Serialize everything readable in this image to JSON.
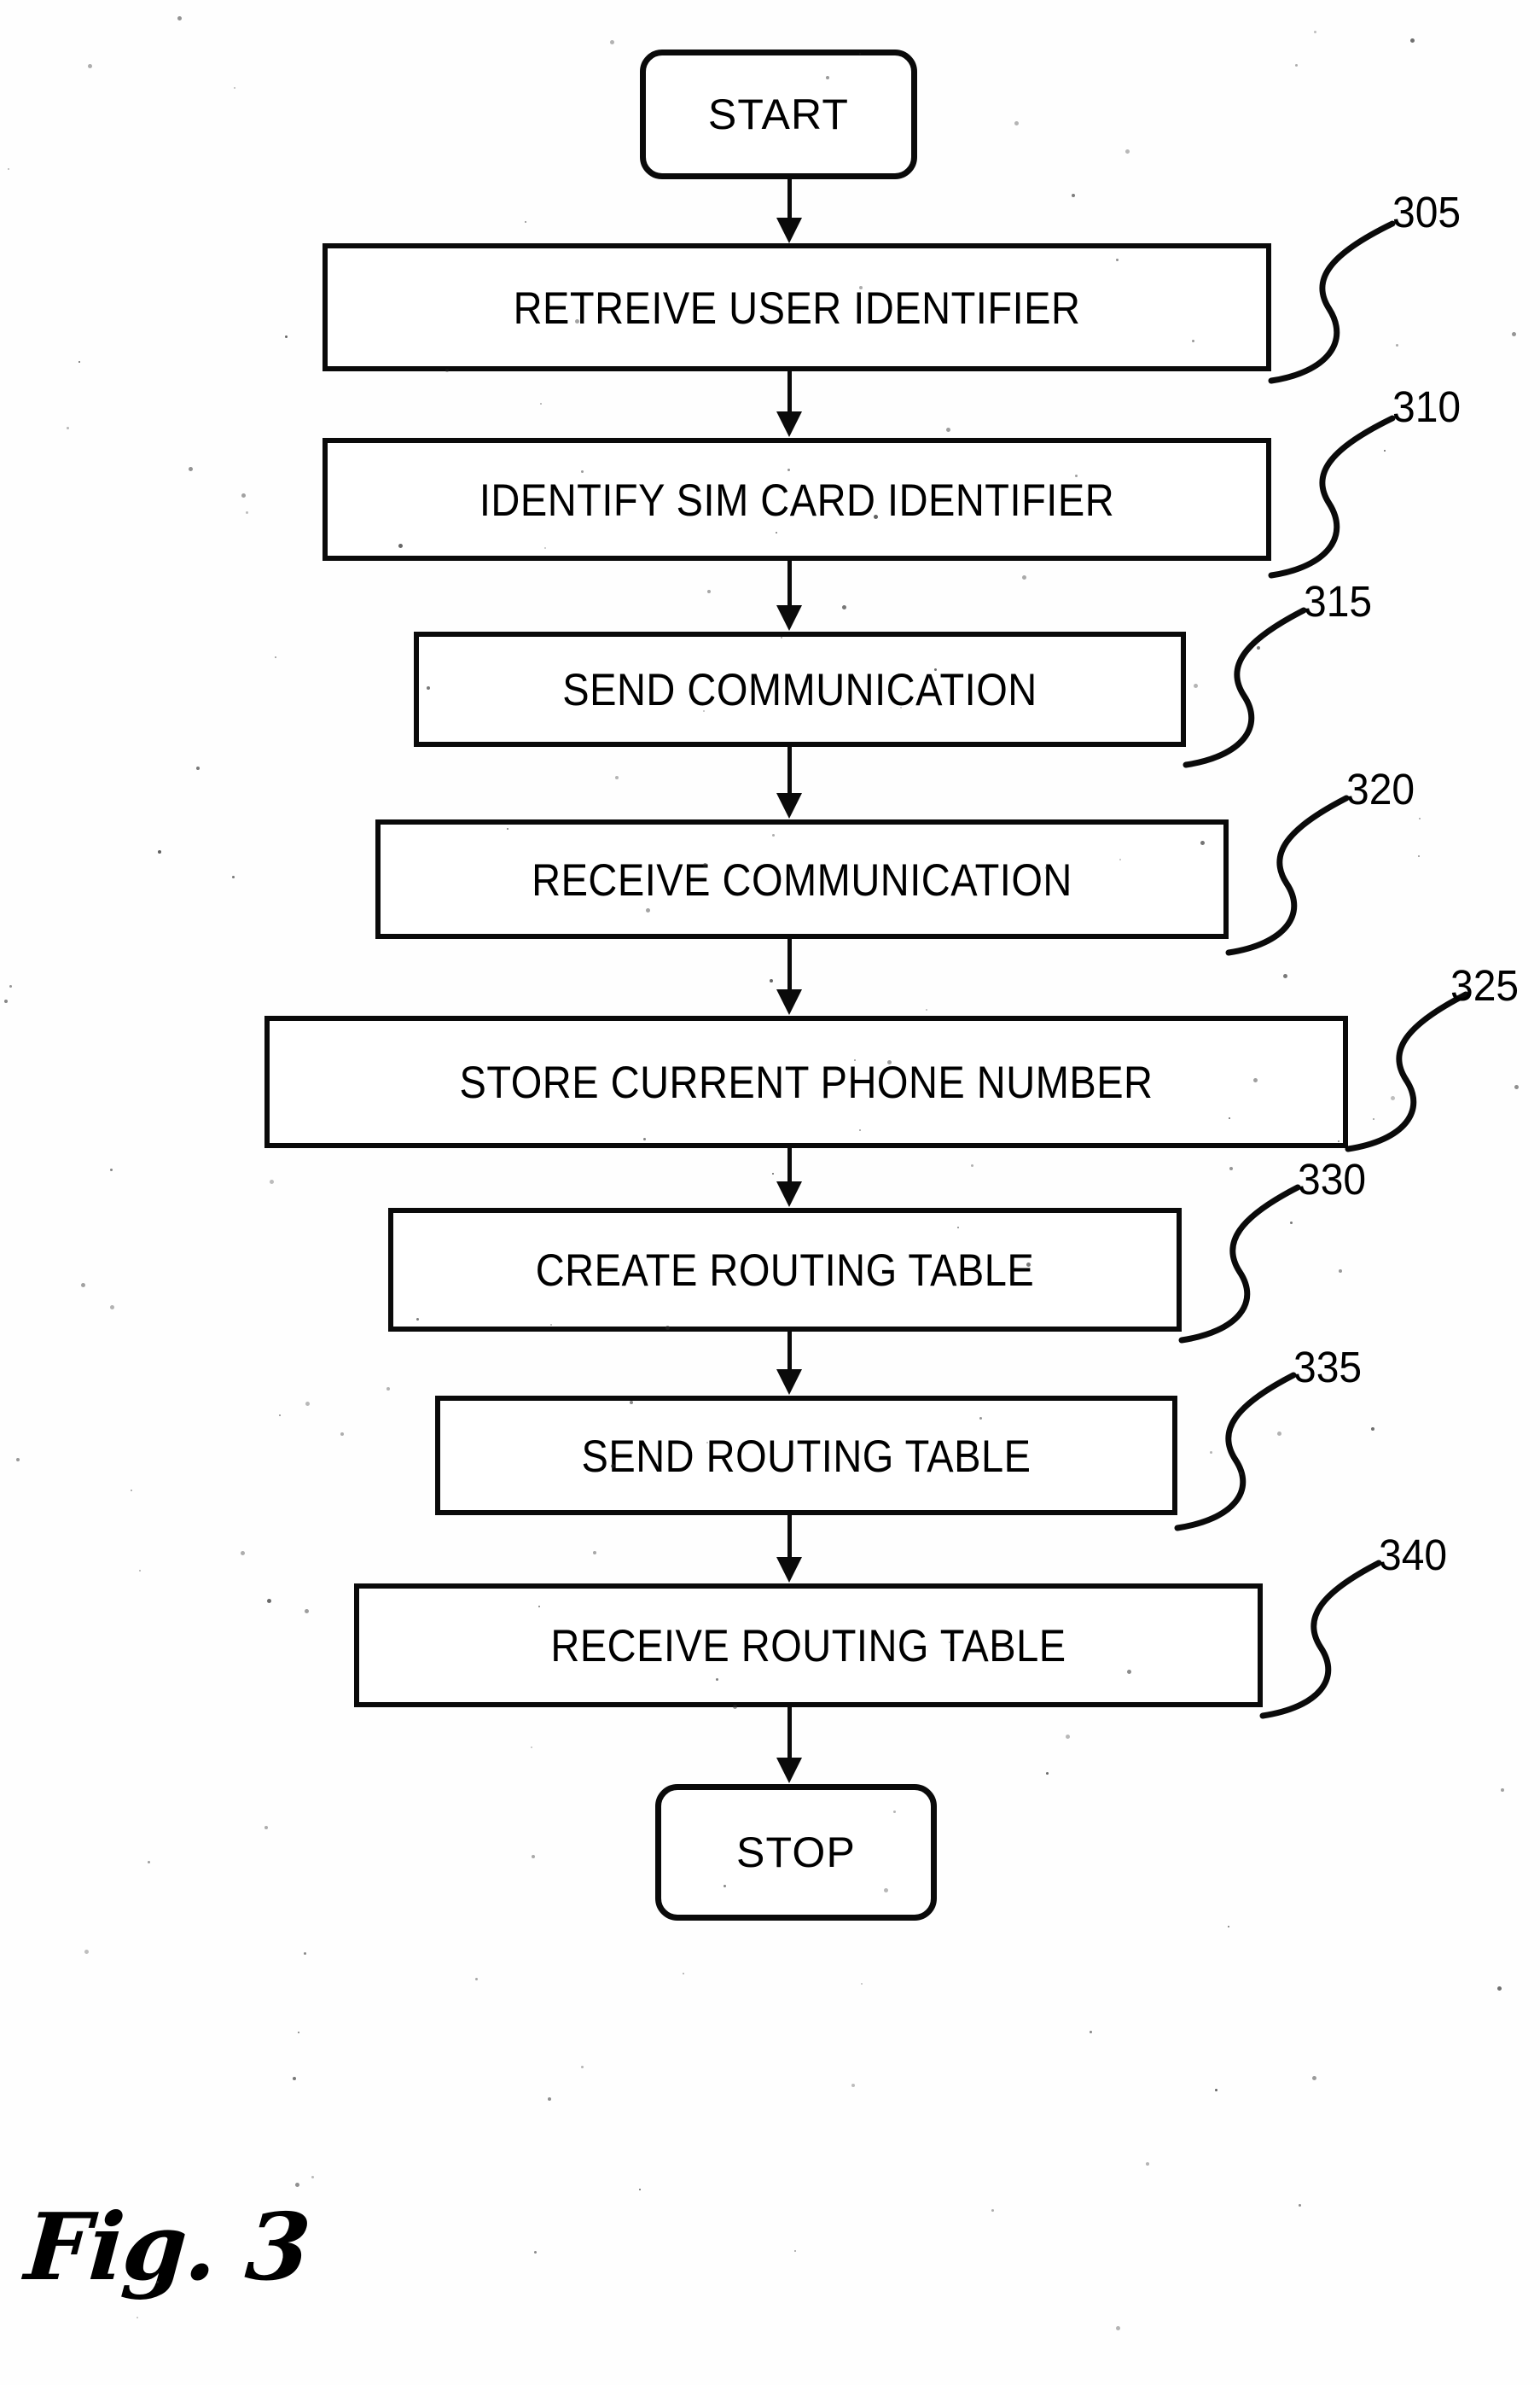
{
  "figure": {
    "caption": "Fig. 3",
    "kind": "patent-flowchart"
  },
  "nodes": [
    {
      "id": "start",
      "label": "START",
      "ref": "",
      "shape": "terminal"
    },
    {
      "id": "n305",
      "label": "RETREIVE USER IDENTIFIER",
      "ref": "305",
      "shape": "process"
    },
    {
      "id": "n310",
      "label": "IDENTIFY SIM CARD IDENTIFIER",
      "ref": "310",
      "shape": "process"
    },
    {
      "id": "n315",
      "label": "SEND COMMUNICATION",
      "ref": "315",
      "shape": "process"
    },
    {
      "id": "n320",
      "label": "RECEIVE COMMUNICATION",
      "ref": "320",
      "shape": "process"
    },
    {
      "id": "n325",
      "label": "STORE CURRENT PHONE NUMBER",
      "ref": "325",
      "shape": "process"
    },
    {
      "id": "n330",
      "label": "CREATE ROUTING TABLE",
      "ref": "330",
      "shape": "process"
    },
    {
      "id": "n335",
      "label": "SEND ROUTING TABLE",
      "ref": "335",
      "shape": "process"
    },
    {
      "id": "n340",
      "label": "RECEIVE ROUTING TABLE",
      "ref": "340",
      "shape": "process"
    },
    {
      "id": "stop",
      "label": "STOP",
      "ref": "",
      "shape": "terminal"
    }
  ],
  "reference_numerals": [
    "305",
    "310",
    "315",
    "320",
    "325",
    "330",
    "335",
    "340"
  ],
  "colors": {
    "ink": "#0a0a0a",
    "paper": "#ffffff"
  }
}
